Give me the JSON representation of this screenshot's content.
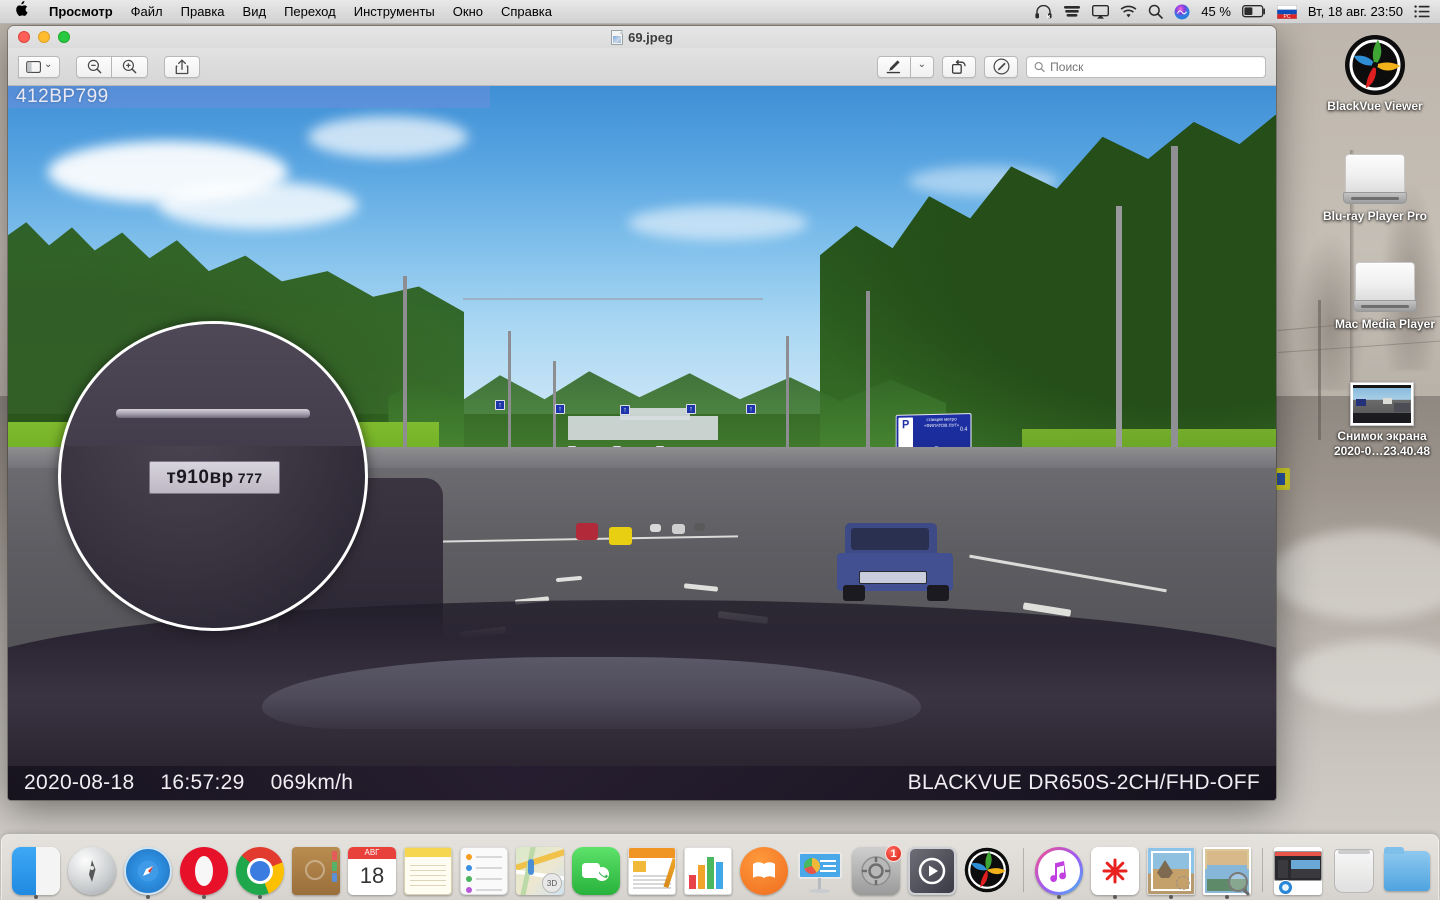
{
  "menubar": {
    "apple_glyph": "",
    "items": [
      {
        "label": "Просмотр",
        "bold": true
      },
      {
        "label": "Файл",
        "bold": false
      },
      {
        "label": "Правка",
        "bold": false
      },
      {
        "label": "Вид",
        "bold": false
      },
      {
        "label": "Переход",
        "bold": false
      },
      {
        "label": "Инструменты",
        "bold": false
      },
      {
        "label": "Окно",
        "bold": false
      },
      {
        "label": "Справка",
        "bold": false
      }
    ],
    "tray": {
      "headphones_icon": "headphones-icon",
      "timemachine_icon": "time-machine-icon",
      "airplay_icon": "airplay-icon",
      "wifi_icon": "wifi-icon",
      "spotlight_icon": "search-icon",
      "siri_icon": "siri-icon",
      "battery_percent": "45 %",
      "battery_icon": "battery-icon",
      "input_source": "РС",
      "input_flag": "russian-flag-icon",
      "clock": "Вт, 18 авг.  23:50",
      "notification_center_icon": "notification-center-icon"
    }
  },
  "window": {
    "title": "69.jpeg",
    "traffic_lights": {
      "close": "close",
      "minimize": "minimize",
      "zoom": "zoom"
    },
    "toolbar": {
      "sidebar_label": "sidebar-view",
      "sidebar_chevron": "⌄",
      "zoom_out_label": "zoom-out",
      "zoom_in_label": "zoom-in",
      "share_label": "share",
      "markup_label": "markup",
      "markup_chevron": "⌄",
      "rotate_label": "rotate",
      "annotate_label": "annotate",
      "search_placeholder": "Поиск",
      "search_value": ""
    }
  },
  "photo": {
    "osd_top_text": "412ВР799",
    "osd_date": "2020-08-18",
    "osd_time": "16:57:29",
    "osd_speed": "069km/h",
    "osd_device": "BLACKVUE  DR650S-2CH/FHD-OFF",
    "magnifier": {
      "plate_main": "т910вр",
      "plate_region": "777"
    },
    "road_sign": {
      "parking_symbol": "P",
      "line1": "станция метро",
      "line2": "«ФИЛАТОВ ЛУГ»",
      "distance": "0.4",
      "arrow": "↗"
    }
  },
  "desktop_icons": [
    {
      "name": "BlackVue Viewer",
      "type": "app",
      "label": "BlackVue Viewer",
      "label2": ""
    },
    {
      "name": "Blu-ray Player Pro",
      "type": "drive",
      "label": "Blu-ray Player Pro",
      "label2": ""
    },
    {
      "name": "Mac Media Player",
      "type": "drive",
      "label": "Mac Media Player",
      "label2": ""
    },
    {
      "name": "Снимок экрана",
      "type": "screenshot",
      "label": "Снимок экрана",
      "label2": "2020-0…23.40.48"
    }
  ],
  "dock": {
    "items": [
      {
        "name": "finder",
        "label": "Finder",
        "running": true,
        "badge": ""
      },
      {
        "name": "launchpad",
        "label": "Launchpad",
        "running": false,
        "badge": ""
      },
      {
        "name": "safari",
        "label": "Safari",
        "running": true,
        "badge": ""
      },
      {
        "name": "opera",
        "label": "Opera",
        "running": true,
        "badge": ""
      },
      {
        "name": "chrome",
        "label": "Google Chrome",
        "running": true,
        "badge": ""
      },
      {
        "name": "contacts",
        "label": "Контакты",
        "running": false,
        "badge": ""
      },
      {
        "name": "calendar",
        "label": "Календарь",
        "running": false,
        "badge": "",
        "month": "АВГ",
        "day": "18"
      },
      {
        "name": "notes",
        "label": "Заметки",
        "running": false,
        "badge": ""
      },
      {
        "name": "reminders",
        "label": "Напоминания",
        "running": false,
        "badge": ""
      },
      {
        "name": "maps",
        "label": "Карты",
        "running": false,
        "badge": ""
      },
      {
        "name": "facetime",
        "label": "FaceTime",
        "running": false,
        "badge": ""
      },
      {
        "name": "pages",
        "label": "Pages",
        "running": false,
        "badge": ""
      },
      {
        "name": "numbers",
        "label": "Numbers",
        "running": false,
        "badge": ""
      },
      {
        "name": "books",
        "label": "Книги",
        "running": false,
        "badge": ""
      },
      {
        "name": "keynote",
        "label": "Keynote",
        "running": false,
        "badge": ""
      },
      {
        "name": "system-preferences",
        "label": "Системные настройки",
        "running": false,
        "badge": "1"
      },
      {
        "name": "quicktime",
        "label": "QuickTime Player",
        "running": false,
        "badge": ""
      },
      {
        "name": "blackvue-viewer",
        "label": "BlackVue Viewer",
        "running": false,
        "badge": ""
      },
      {
        "name": "itunes",
        "label": "iTunes",
        "running": true,
        "badge": ""
      },
      {
        "name": "jetbrains",
        "label": "JetBrains Toolbox",
        "running": true,
        "badge": ""
      },
      {
        "name": "mail",
        "label": "Почта",
        "running": true,
        "badge": ""
      },
      {
        "name": "preview",
        "label": "Просмотр",
        "running": true,
        "badge": ""
      },
      {
        "name": "screen-sharing",
        "label": "Общий экран",
        "running": false,
        "badge": ""
      },
      {
        "name": "trash",
        "label": "Корзина",
        "running": false,
        "badge": ""
      },
      {
        "name": "downloads-folder",
        "label": "Загрузки",
        "running": false,
        "badge": ""
      }
    ]
  },
  "colors": {
    "menubar_bg": "#dcdcdc",
    "window_chrome": "#e2e2e2",
    "accent_blue": "#1c2fa5",
    "osd_overlay": "rgba(120,140,220,.42)",
    "dock_bg": "rgba(236,234,230,.8)",
    "badge_red": "#d81f12"
  }
}
